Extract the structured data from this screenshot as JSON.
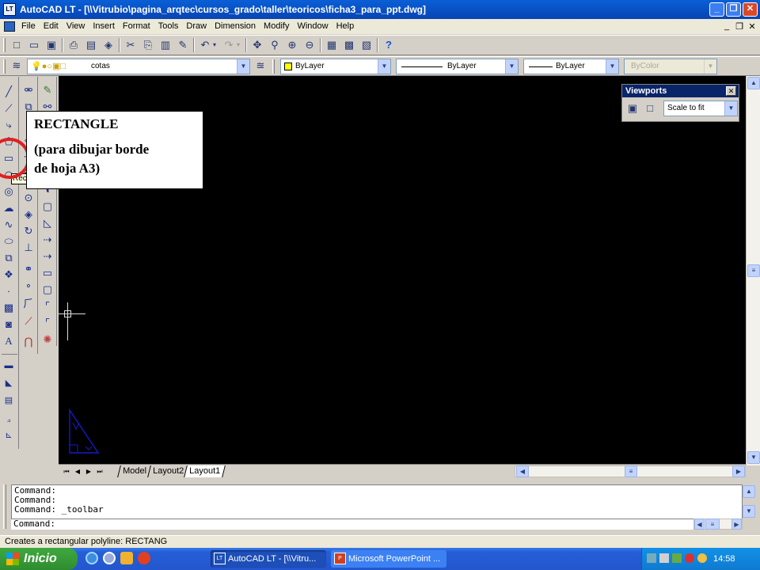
{
  "window": {
    "title": "AutoCAD LT - [\\\\Vitrubio\\pagina_arqtec\\cursos_grado\\taller\\teoricos\\ficha3_para_ppt.dwg]",
    "app_icon": "LT",
    "minimize": "_",
    "restore": "❐",
    "close": "✕"
  },
  "menubar": {
    "items": [
      "File",
      "Edit",
      "View",
      "Insert",
      "Format",
      "Tools",
      "Draw",
      "Dimension",
      "Modify",
      "Window",
      "Help"
    ],
    "doc_controls": [
      "_",
      "❐",
      "✕"
    ]
  },
  "layers_toolbar": {
    "layer_name": "cotas",
    "color": "ByLayer",
    "linetype": "ByLayer",
    "lineweight": "ByLayer",
    "plotstyle": "ByColor"
  },
  "tooltip_fragment": "Rec",
  "callout": {
    "title": "RECTANGLE",
    "line1": "(para dibujar borde",
    "line2": "de hoja A3)"
  },
  "viewports_toolbar": {
    "title": "Viewports",
    "scale": "Scale to fit"
  },
  "layout_tabs": [
    "Model",
    "Layout2",
    "Layout1"
  ],
  "active_tab": "Layout1",
  "command": {
    "history": [
      "Command:",
      "Command:",
      "Command: _toolbar"
    ],
    "prompt": "Command:"
  },
  "status_bar": {
    "text": "Creates a rectangular polyline:  RECTANG"
  },
  "taskbar": {
    "start_label": "Inicio",
    "buttons": [
      {
        "label": "AutoCAD LT - [\\\\Vitru...",
        "icon": "LT"
      },
      {
        "label": "Microsoft PowerPoint ...",
        "icon": "P"
      }
    ],
    "clock": "14:58"
  },
  "colors": {
    "titlebar": "#0744b4",
    "canvas": "#000000",
    "callout_circle": "#e02020",
    "ucs_icon": "#1818d0"
  }
}
